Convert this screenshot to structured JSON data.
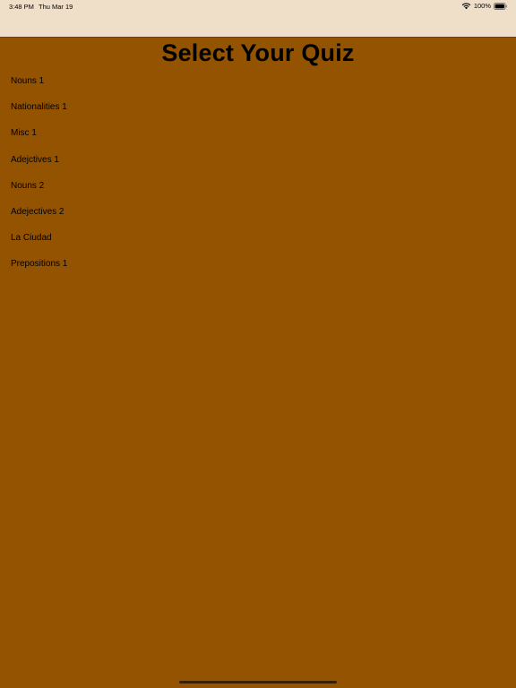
{
  "status_bar": {
    "time": "3:48 PM",
    "date": "Thu Mar 19",
    "battery": "100%"
  },
  "title": "Select Your Quiz",
  "quizzes": [
    {
      "label": "Nouns 1"
    },
    {
      "label": "Nationalities 1"
    },
    {
      "label": "Misc 1"
    },
    {
      "label": "Adejctives 1"
    },
    {
      "label": "Nouns 2"
    },
    {
      "label": "Adejectives 2"
    },
    {
      "label": "La Ciudad"
    },
    {
      "label": "Prepositions 1"
    }
  ],
  "colors": {
    "background": "#935300",
    "top_bar": "#efdfc9",
    "text": "#000000"
  }
}
